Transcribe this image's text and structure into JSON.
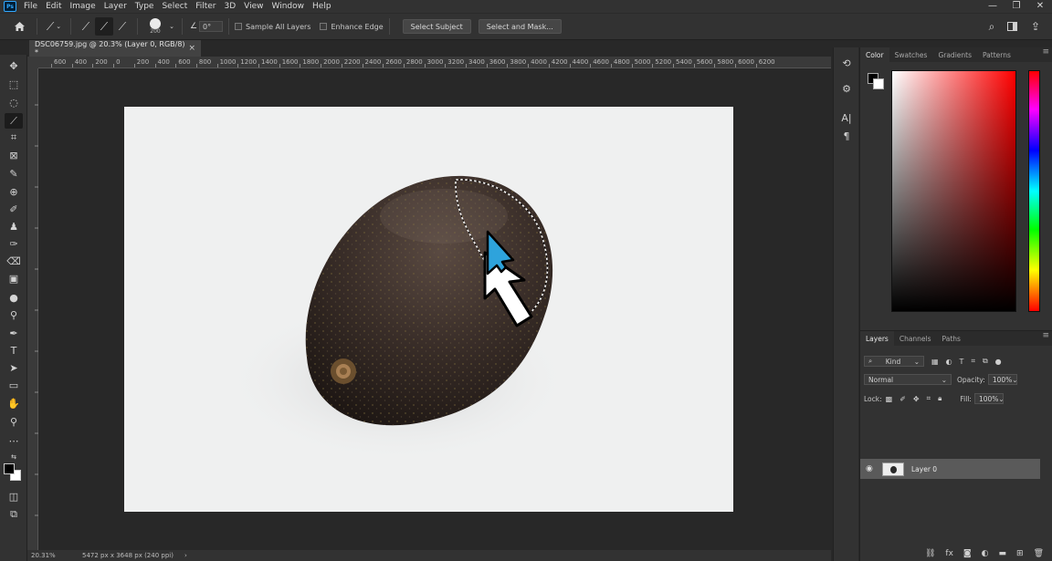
{
  "menubar": {
    "logo": "Ps",
    "items": [
      "File",
      "Edit",
      "Image",
      "Layer",
      "Type",
      "Select",
      "Filter",
      "3D",
      "View",
      "Window",
      "Help"
    ],
    "window_controls": [
      "—",
      "❐",
      "✕"
    ]
  },
  "options": {
    "brush_size": "200",
    "angle": "0°",
    "sample_all_layers": "Sample All Layers",
    "enhance_edge": "Enhance Edge",
    "select_subject": "Select Subject",
    "select_and_mask": "Select and Mask..."
  },
  "document": {
    "tab_title": "DSC06759.jpg @ 20.3% (Layer 0, RGB/8) *",
    "close": "×"
  },
  "ruler_labels": [
    "600",
    "400",
    "200",
    "0",
    "200",
    "400",
    "600",
    "800",
    "1000",
    "1200",
    "1400",
    "1600",
    "1800",
    "2000",
    "2200",
    "2400",
    "2600",
    "2800",
    "3000",
    "3200",
    "3400",
    "3600",
    "3800",
    "4000",
    "4200",
    "4400",
    "4600",
    "4800",
    "5000",
    "5200",
    "5400",
    "5600",
    "5800",
    "6000",
    "6200"
  ],
  "status": {
    "zoom": "20.31%",
    "doc_info": "5472 px x 3648 px (240 ppi)"
  },
  "color_panel": {
    "tabs": [
      "Color",
      "Swatches",
      "Gradients",
      "Patterns"
    ],
    "foreground": "#000000",
    "background": "#ffffff"
  },
  "layers_panel": {
    "tabs": [
      "Layers",
      "Channels",
      "Paths"
    ],
    "filter_kind": "Kind",
    "blend_mode": "Normal",
    "opacity_label": "Opacity:",
    "opacity_value": "100%",
    "lock_label": "Lock:",
    "fill_label": "Fill:",
    "fill_value": "100%",
    "layer_name": "Layer 0"
  }
}
